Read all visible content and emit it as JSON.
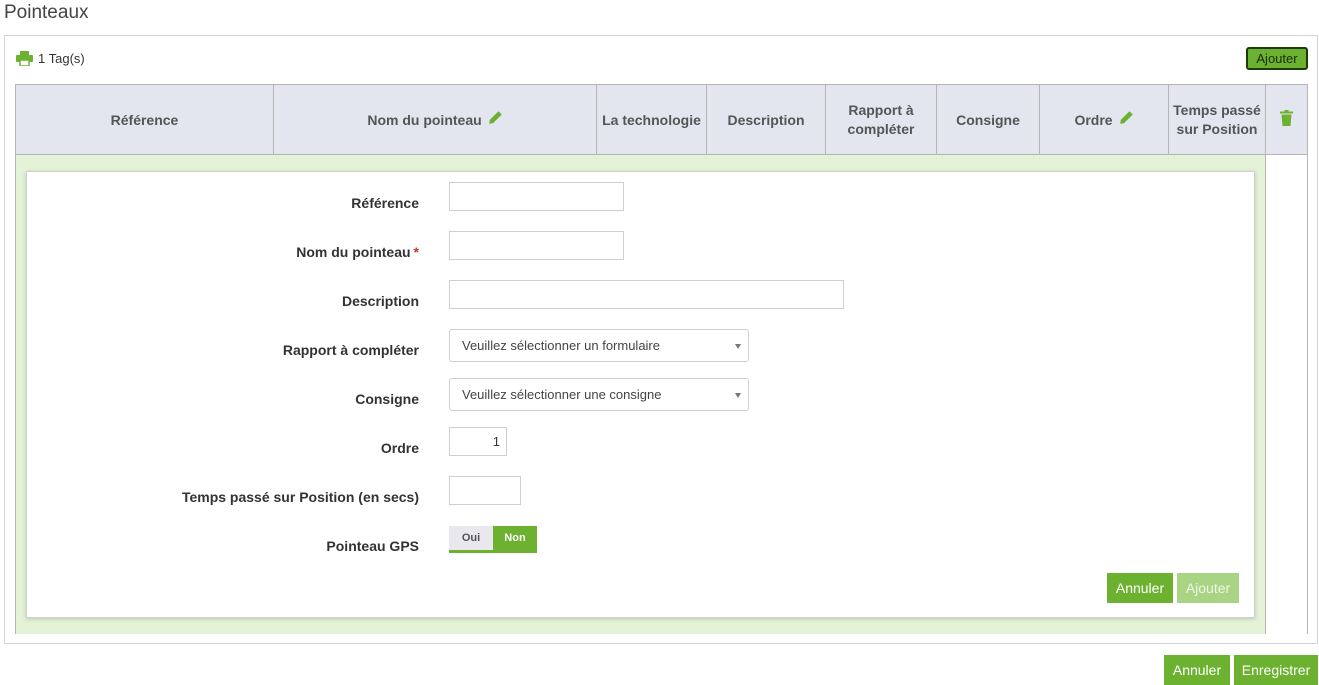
{
  "page": {
    "title": "Pointeaux"
  },
  "toolbar": {
    "tag_count": "1 Tag(s)",
    "add_label": "Ajouter"
  },
  "table": {
    "columns": {
      "reference": "Référence",
      "nom": "Nom du pointeau",
      "technologie": "La technologie",
      "description": "Description",
      "rapport": "Rapport à compléter",
      "consigne": "Consigne",
      "ordre": "Ordre",
      "temps": "Temps passé sur Position"
    }
  },
  "form": {
    "reference_label": "Référence",
    "reference_value": "",
    "nom_label": "Nom du pointeau",
    "required_mark": "*",
    "nom_value": "",
    "description_label": "Description",
    "description_value": "",
    "rapport_label": "Rapport à compléter",
    "rapport_placeholder": "Veuillez sélectionner un formulaire",
    "consigne_label": "Consigne",
    "consigne_placeholder": "Veuillez sélectionner une consigne",
    "ordre_label": "Ordre",
    "ordre_value": "1",
    "temps_label": "Temps passé sur Position (en secs)",
    "temps_value": "",
    "gps_label": "Pointeau GPS",
    "gps_options": {
      "oui": "Oui",
      "non": "Non"
    },
    "gps_selected": "Non",
    "cancel_label": "Annuler",
    "add_label": "Ajouter"
  },
  "footer": {
    "cancel_label": "Annuler",
    "save_label": "Enregistrer"
  },
  "icons": {
    "print": "print-icon",
    "pencil": "pencil-icon",
    "trash": "trash-icon",
    "caret": "chevron-down-icon"
  },
  "colors": {
    "accent": "#6cb230",
    "edit_row": "#e4f2d8",
    "header": "#e3e6ee"
  }
}
